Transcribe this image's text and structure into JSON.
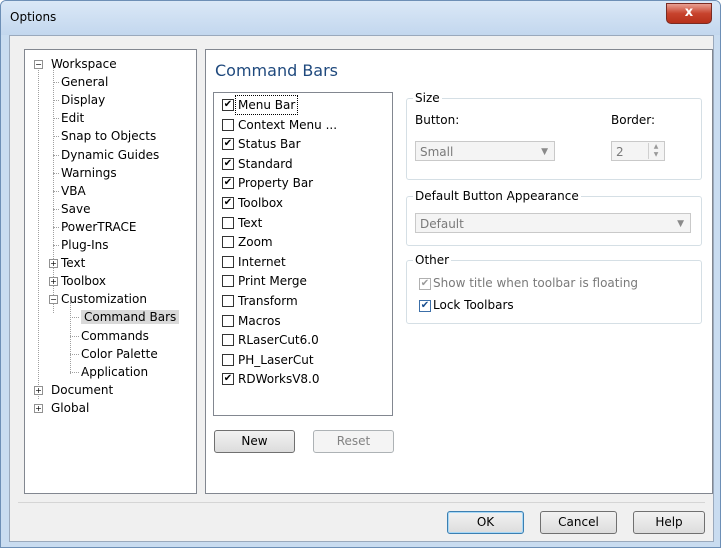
{
  "window": {
    "title": "Options",
    "close_glyph": "x"
  },
  "tree": {
    "items": [
      {
        "label": "Workspace",
        "expander": "−"
      },
      {
        "label": "General"
      },
      {
        "label": "Display"
      },
      {
        "label": "Edit"
      },
      {
        "label": "Snap to Objects"
      },
      {
        "label": "Dynamic Guides"
      },
      {
        "label": "Warnings"
      },
      {
        "label": "VBA"
      },
      {
        "label": "Save"
      },
      {
        "label": "PowerTRACE"
      },
      {
        "label": "Plug-Ins"
      },
      {
        "label": "Text",
        "expander": "+"
      },
      {
        "label": "Toolbox",
        "expander": "+"
      },
      {
        "label": "Customization",
        "expander": "−"
      },
      {
        "label": "Command Bars",
        "selected": true
      },
      {
        "label": "Commands"
      },
      {
        "label": "Color Palette"
      },
      {
        "label": "Application"
      },
      {
        "label": "Document",
        "expander": "+"
      },
      {
        "label": "Global",
        "expander": "+"
      }
    ]
  },
  "panel": {
    "heading": "Command Bars",
    "bars": [
      {
        "label": "Menu Bar",
        "checked": true
      },
      {
        "label": "Context Menu ...",
        "checked": false
      },
      {
        "label": "Status Bar",
        "checked": true
      },
      {
        "label": "Standard",
        "checked": true
      },
      {
        "label": "Property Bar",
        "checked": true
      },
      {
        "label": "Toolbox",
        "checked": true
      },
      {
        "label": "Text",
        "checked": false
      },
      {
        "label": "Zoom",
        "checked": false
      },
      {
        "label": "Internet",
        "checked": false
      },
      {
        "label": "Print Merge",
        "checked": false
      },
      {
        "label": "Transform",
        "checked": false
      },
      {
        "label": "Macros",
        "checked": false
      },
      {
        "label": "RLaserCut6.0",
        "checked": false
      },
      {
        "label": "PH_LaserCut",
        "checked": false
      },
      {
        "label": "RDWorksV8.0",
        "checked": true
      }
    ],
    "check_glyph": "✔",
    "new_label": "New",
    "reset_label": "Reset"
  },
  "size": {
    "legend": "Size",
    "button_label": "Button:",
    "button_value": "Small",
    "border_label": "Border:",
    "border_value": "2"
  },
  "appearance": {
    "legend": "Default Button Appearance",
    "value": "Default"
  },
  "other": {
    "legend": "Other",
    "show_title_label": "Show title when toolbar is floating",
    "show_title_checked": true,
    "lock_label": "Lock Toolbars",
    "lock_checked": true
  },
  "footer": {
    "ok_label": "OK",
    "cancel_label": "Cancel",
    "help_label": "Help"
  },
  "icons": {
    "dropdown": "chevron-down-icon",
    "spin": "spin-arrows-icon"
  }
}
